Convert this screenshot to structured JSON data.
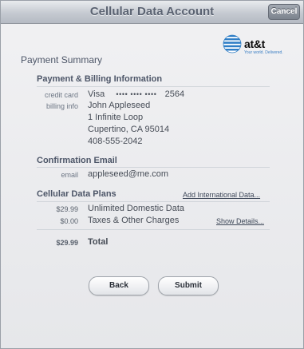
{
  "header": {
    "title": "Cellular Data Account",
    "cancel_label": "Cancel"
  },
  "logo": {
    "brand": "at&t",
    "tagline": "Your world. Delivered.",
    "colors": {
      "globe": "#2f7ec6",
      "tagline": "#3f81c5"
    }
  },
  "summary": {
    "title": "Payment Summary"
  },
  "billing": {
    "title": "Payment & Billing Information",
    "credit_card_label": "credit card",
    "card_type": "Visa",
    "card_mask": "•••• •••• ••••",
    "card_last4": "2564",
    "billing_info_label": "billing info",
    "name": "John Appleseed",
    "address1": "1 Infinite Loop",
    "address2": "Cupertino, CA 95014",
    "phone": "408-555-2042"
  },
  "confirmation": {
    "title": "Confirmation Email",
    "email_label": "email",
    "email": "appleseed@me.com"
  },
  "plans": {
    "title": "Cellular Data Plans",
    "add_international_link": "Add International Data...",
    "items": [
      {
        "amount": "$29.99",
        "description": "Unlimited Domestic Data"
      },
      {
        "amount": "$0.00",
        "description": "Taxes & Other Charges"
      }
    ],
    "show_details_link": "Show Details...",
    "total_amount": "$29.99",
    "total_label": "Total"
  },
  "buttons": {
    "back_label": "Back",
    "submit_label": "Submit"
  }
}
